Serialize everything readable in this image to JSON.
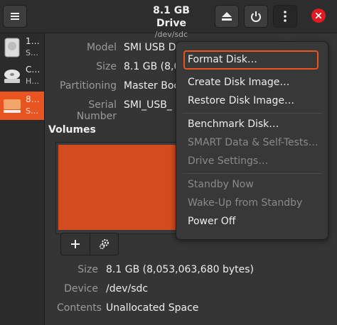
{
  "header": {
    "title": "8.1 GB Drive",
    "subtitle": "/dev/sdc",
    "menu_icon": "hamburger-icon",
    "eject_icon": "eject-icon",
    "power_icon": "power-icon",
    "more_icon": "vertical-dots-icon",
    "close_icon": "close-icon"
  },
  "sidebar": {
    "items": [
      {
        "name": "1…",
        "sub": "S…",
        "icon": "disk-drive-icon",
        "selected": false
      },
      {
        "name": "C…",
        "sub": "H…",
        "icon": "optical-drive-icon",
        "selected": false
      },
      {
        "name": "8…",
        "sub": "S…",
        "icon": "usb-drive-icon",
        "selected": true
      }
    ]
  },
  "properties": {
    "model_label": "Model",
    "model_value": "SMI USB D",
    "size_label": "Size",
    "size_value": "8.1 GB (8,0",
    "partitioning_label": "Partitioning",
    "partitioning_value": "Master Boo",
    "serial_label": "Serial Number",
    "serial_value": "SMI_USB_"
  },
  "volumes": {
    "heading": "Volumes",
    "add_icon": "plus-icon",
    "settings_icon": "gears-icon"
  },
  "details": {
    "size_label": "Size",
    "size_value": "8.1 GB (8,053,063,680 bytes)",
    "device_label": "Device",
    "device_value": "/dev/sdc",
    "contents_label": "Contents",
    "contents_value": "Unallocated Space"
  },
  "menu": {
    "format_disk": "Format Disk…",
    "create_image": "Create Disk Image…",
    "restore_image": "Restore Disk Image…",
    "benchmark": "Benchmark Disk…",
    "smart": "SMART Data & Self-Tests…",
    "drive_settings": "Drive Settings…",
    "standby_now": "Standby Now",
    "wakeup": "Wake-Up from Standby",
    "power_off": "Power Off"
  },
  "colors": {
    "accent": "#e95420",
    "volume_fill": "#d24c1f",
    "close": "#e01b24"
  }
}
